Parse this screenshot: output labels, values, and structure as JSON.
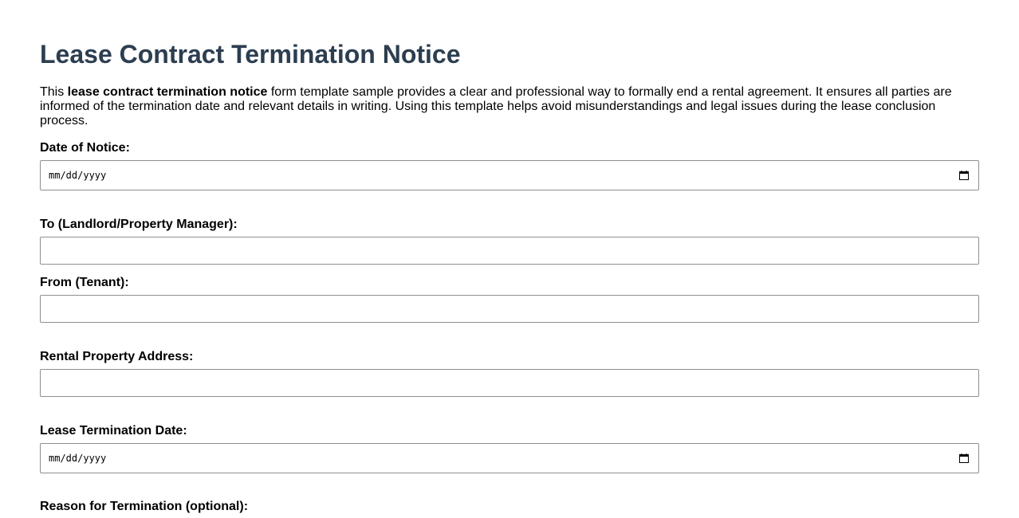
{
  "page_title": "Lease Contract Termination Notice",
  "intro": {
    "prefix": "This ",
    "bold": "lease contract termination notice",
    "suffix": " form template sample provides a clear and professional way to formally end a rental agreement. It ensures all parties are informed of the termination date and relevant details in writing. Using this template helps avoid misunderstandings and legal issues during the lease conclusion process."
  },
  "fields": {
    "date_of_notice": {
      "label": "Date of Notice:",
      "placeholder": "mm/dd/yyyy",
      "value": ""
    },
    "to": {
      "label": "To (Landlord/Property Manager):",
      "value": ""
    },
    "from": {
      "label": "From (Tenant):",
      "value": ""
    },
    "address": {
      "label": "Rental Property Address:",
      "value": ""
    },
    "termination_date": {
      "label": "Lease Termination Date:",
      "placeholder": "mm/dd/yyyy",
      "value": ""
    },
    "reason": {
      "label": "Reason for Termination (optional):"
    }
  },
  "icons": {
    "calendar": "calendar-icon"
  },
  "colors": {
    "title": "#2c3e50",
    "border": "#8f8f8f"
  }
}
